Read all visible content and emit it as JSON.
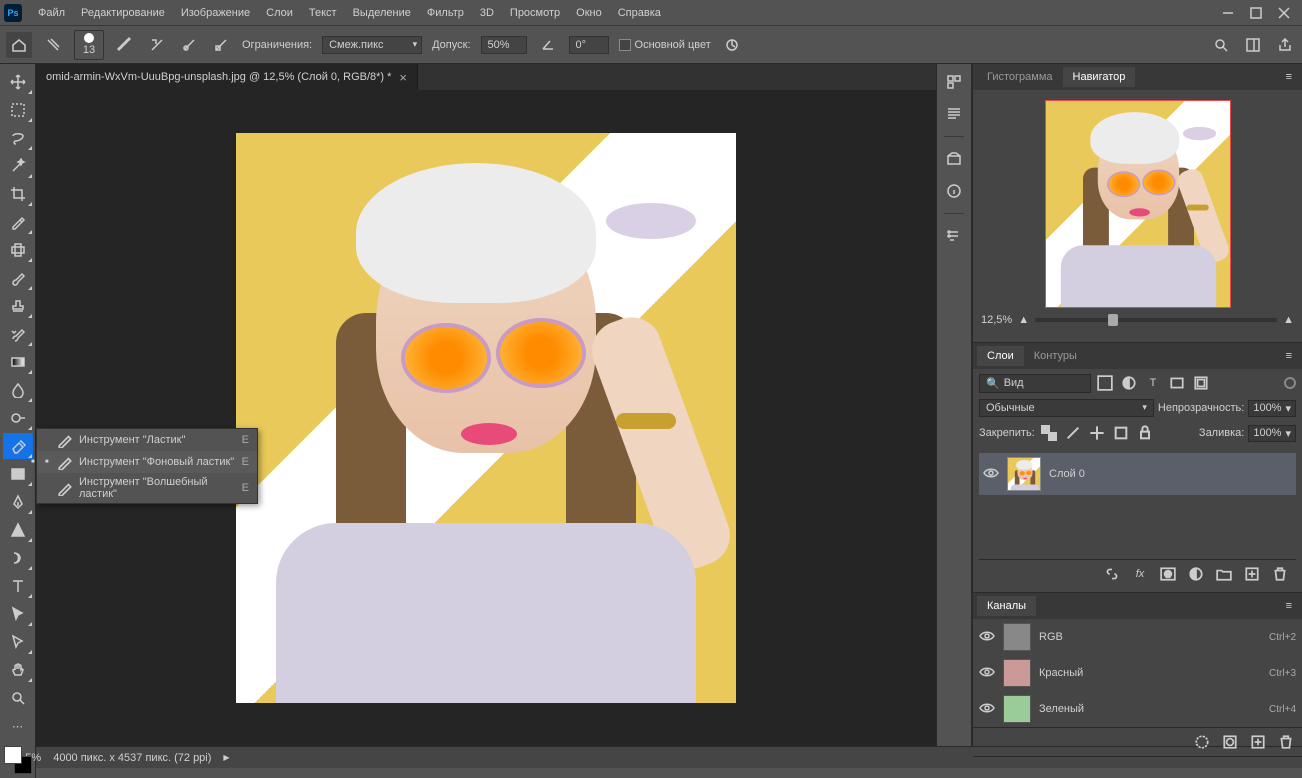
{
  "menu": [
    "Файл",
    "Редактирование",
    "Изображение",
    "Слои",
    "Текст",
    "Выделение",
    "Фильтр",
    "3D",
    "Просмотр",
    "Окно",
    "Справка"
  ],
  "options": {
    "brush_size": "13",
    "limits_label": "Ограничения:",
    "limits_value": "Смеж.пикс",
    "tolerance_label": "Допуск:",
    "tolerance_value": "50%",
    "angle_value": "0°",
    "main_color": "Основной цвет"
  },
  "doc": {
    "tab": "omid-armin-WxVm-UuuBpg-unsplash.jpg @ 12,5% (Слой 0, RGB/8*) *"
  },
  "flyout": [
    {
      "label": "Инструмент \"Ластик\"",
      "key": "E",
      "sel": false
    },
    {
      "label": "Инструмент \"Фоновый ластик\"",
      "key": "E",
      "sel": true
    },
    {
      "label": "Инструмент \"Волшебный ластик\"",
      "key": "E",
      "sel": false
    }
  ],
  "nav": {
    "tab_hist": "Гистограмма",
    "tab_nav": "Навигатор",
    "zoom": "12,5%"
  },
  "layers": {
    "tab_layers": "Слои",
    "tab_paths": "Контуры",
    "kind": "Вид",
    "blend": "Обычные",
    "opacity_label": "Непрозрачность:",
    "opacity": "100%",
    "lock_label": "Закрепить:",
    "fill_label": "Заливка:",
    "fill": "100%",
    "layer_name": "Слой 0"
  },
  "channels": {
    "title": "Каналы",
    "rows": [
      {
        "name": "RGB",
        "key": "Ctrl+2"
      },
      {
        "name": "Красный",
        "key": "Ctrl+3"
      },
      {
        "name": "Зеленый",
        "key": "Ctrl+4"
      }
    ]
  },
  "status": {
    "zoom": "12,5%",
    "dim": "4000 пикс. x 4537 пикс. (72 ppi)"
  }
}
